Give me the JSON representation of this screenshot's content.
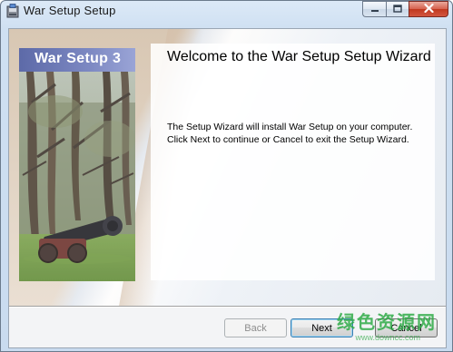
{
  "window": {
    "title": "War Setup Setup",
    "icon": "setup-installer-icon"
  },
  "caption_buttons": {
    "minimize_icon": "minimize-icon",
    "maximize_icon": "maximize-icon",
    "close_icon": "close-icon"
  },
  "side_panel": {
    "banner_text": "War Setup 3"
  },
  "content": {
    "heading": "Welcome to the War Setup Setup Wizard",
    "description_line1": "The Setup Wizard will install War Setup on your computer.",
    "description_line2": "Click Next to continue or Cancel to exit the Setup Wizard."
  },
  "buttons": {
    "back_label": "Back",
    "next_label": "Next",
    "cancel_label": "Cancel",
    "back_enabled": false
  },
  "watermark": {
    "main": "绿色资源网",
    "sub": "www.downcc.com"
  },
  "colors": {
    "banner": "#7c88c2",
    "close_button": "#c0381f",
    "default_button_border": "#3c7fb1",
    "watermark": "#2eaa46"
  }
}
